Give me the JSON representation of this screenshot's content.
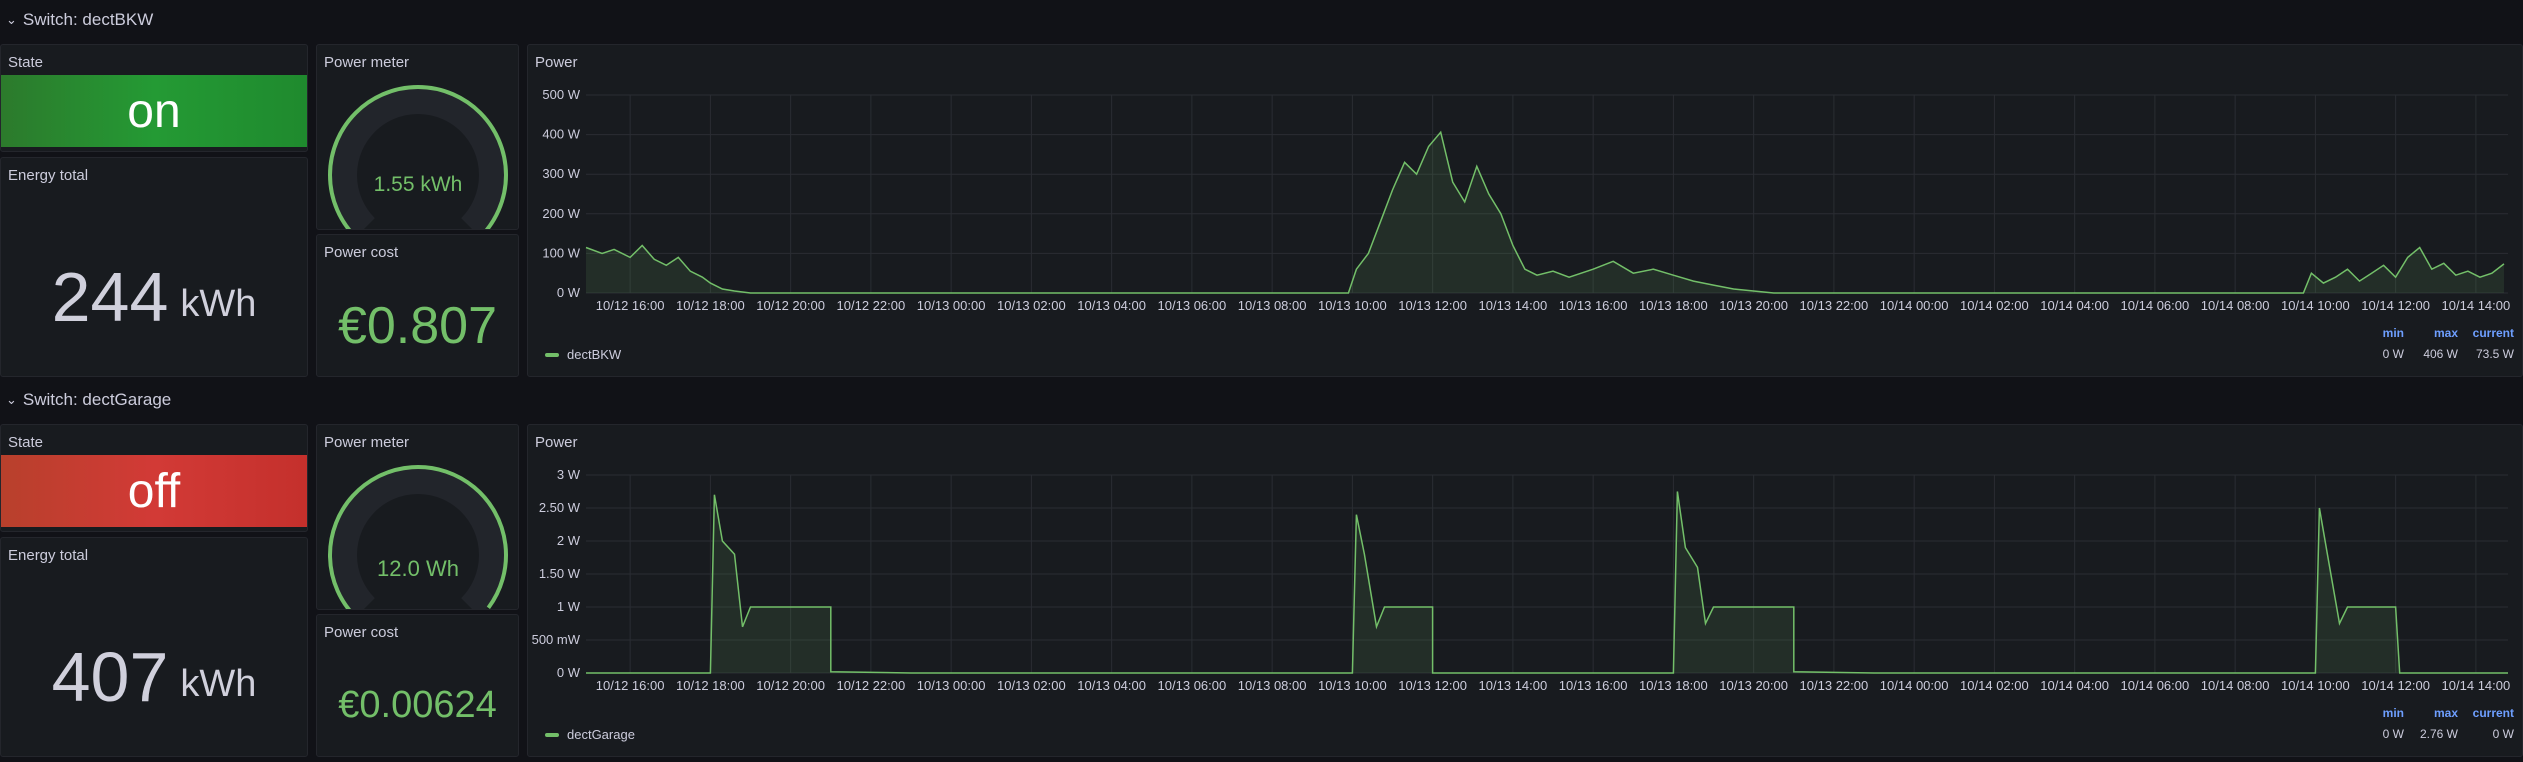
{
  "sections": [
    {
      "row_title": "Switch: dectBKW",
      "state": {
        "title": "State",
        "value": "on"
      },
      "energy": {
        "title": "Energy total",
        "value": "244",
        "unit": "kWh"
      },
      "meter": {
        "title": "Power meter",
        "value": "1.55 kWh",
        "gauge_fraction": 1.0
      },
      "cost": {
        "title": "Power cost",
        "value": "€0.807"
      },
      "chart_title": "Power",
      "legend": "dectBKW",
      "stats_headers": [
        "min",
        "max",
        "current"
      ],
      "stats_values": [
        "0 W",
        "406 W",
        "73.5 W"
      ]
    },
    {
      "row_title": "Switch: dectGarage",
      "state": {
        "title": "State",
        "value": "off"
      },
      "energy": {
        "title": "Energy total",
        "value": "407",
        "unit": "kWh"
      },
      "meter": {
        "title": "Power meter",
        "value": "12.0 Wh",
        "gauge_fraction": 0.97
      },
      "cost": {
        "title": "Power cost",
        "value": "€0.00624"
      },
      "chart_title": "Power",
      "legend": "dectGarage",
      "stats_headers": [
        "min",
        "max",
        "current"
      ],
      "stats_values": [
        "0 W",
        "2.76 W",
        "0 W"
      ]
    }
  ],
  "colors": {
    "accent": "#73bf69",
    "on": "#249a34",
    "off": "#d23a36",
    "stats_header": "#6e9fff"
  },
  "chart_data": [
    {
      "type": "area",
      "title": "Power",
      "series_name": "dectBKW",
      "x_start_hours": 0,
      "x_end_hours": 48,
      "y_ticks": [
        "0 W",
        "100 W",
        "200 W",
        "300 W",
        "400 W",
        "500 W"
      ],
      "y_tick_values": [
        0,
        100,
        200,
        300,
        400,
        500
      ],
      "ylim": [
        0,
        500
      ],
      "x_ticks": [
        "10/12 16:00",
        "10/12 18:00",
        "10/12 20:00",
        "10/12 22:00",
        "10/13 00:00",
        "10/13 02:00",
        "10/13 04:00",
        "10/13 06:00",
        "10/13 08:00",
        "10/13 10:00",
        "10/13 12:00",
        "10/13 14:00",
        "10/13 16:00",
        "10/13 18:00",
        "10/13 20:00",
        "10/13 22:00",
        "10/14 00:00",
        "10/14 02:00",
        "10/14 04:00",
        "10/14 06:00",
        "10/14 08:00",
        "10/14 10:00",
        "10/14 12:00",
        "10/14 14:00"
      ],
      "points": [
        [
          14.9,
          115
        ],
        [
          15.3,
          100
        ],
        [
          15.6,
          110
        ],
        [
          16.0,
          90
        ],
        [
          16.3,
          120
        ],
        [
          16.6,
          85
        ],
        [
          16.9,
          70
        ],
        [
          17.2,
          90
        ],
        [
          17.5,
          55
        ],
        [
          17.8,
          40
        ],
        [
          18.0,
          25
        ],
        [
          18.3,
          10
        ],
        [
          18.6,
          5
        ],
        [
          19,
          0
        ],
        [
          23.5,
          0
        ],
        [
          24,
          0
        ],
        [
          32,
          0
        ],
        [
          33.9,
          0
        ],
        [
          34.1,
          60
        ],
        [
          34.4,
          100
        ],
        [
          34.7,
          180
        ],
        [
          35.0,
          260
        ],
        [
          35.3,
          330
        ],
        [
          35.6,
          300
        ],
        [
          35.9,
          370
        ],
        [
          36.2,
          406
        ],
        [
          36.5,
          280
        ],
        [
          36.8,
          230
        ],
        [
          37.1,
          320
        ],
        [
          37.4,
          250
        ],
        [
          37.7,
          200
        ],
        [
          38.0,
          120
        ],
        [
          38.3,
          60
        ],
        [
          38.6,
          45
        ],
        [
          39.0,
          55
        ],
        [
          39.4,
          40
        ],
        [
          40.0,
          60
        ],
        [
          40.5,
          80
        ],
        [
          41.0,
          50
        ],
        [
          41.5,
          60
        ],
        [
          42.0,
          45
        ],
        [
          42.5,
          30
        ],
        [
          43.0,
          20
        ],
        [
          43.5,
          10
        ],
        [
          44.0,
          5
        ],
        [
          44.5,
          0
        ],
        [
          48.0,
          0
        ],
        [
          56.0,
          0
        ],
        [
          57.7,
          0
        ],
        [
          57.9,
          50
        ],
        [
          58.2,
          25
        ],
        [
          58.5,
          40
        ],
        [
          58.8,
          60
        ],
        [
          59.1,
          30
        ],
        [
          59.4,
          50
        ],
        [
          59.7,
          70
        ],
        [
          60.0,
          40
        ],
        [
          60.3,
          90
        ],
        [
          60.6,
          115
        ],
        [
          60.9,
          60
        ],
        [
          61.2,
          75
        ],
        [
          61.5,
          45
        ],
        [
          61.8,
          55
        ],
        [
          62.1,
          40
        ],
        [
          62.4,
          50
        ],
        [
          62.7,
          73.5
        ]
      ],
      "x_total_hours": 62.8
    },
    {
      "type": "area",
      "title": "Power",
      "series_name": "dectGarage",
      "y_ticks": [
        "0 W",
        "500 mW",
        "1 W",
        "1.50 W",
        "2 W",
        "2.50 W",
        "3 W"
      ],
      "y_tick_values": [
        0,
        0.5,
        1,
        1.5,
        2,
        2.5,
        3
      ],
      "ylim": [
        0,
        3
      ],
      "x_ticks": [
        "10/12 16:00",
        "10/12 18:00",
        "10/12 20:00",
        "10/12 22:00",
        "10/13 00:00",
        "10/13 02:00",
        "10/13 04:00",
        "10/13 06:00",
        "10/13 08:00",
        "10/13 10:00",
        "10/13 12:00",
        "10/13 14:00",
        "10/13 16:00",
        "10/13 18:00",
        "10/13 20:00",
        "10/13 22:00",
        "10/14 00:00",
        "10/14 02:00",
        "10/14 04:00",
        "10/14 06:00",
        "10/14 08:00",
        "10/14 10:00",
        "10/14 12:00",
        "10/14 14:00"
      ],
      "points": [
        [
          14.9,
          0
        ],
        [
          18.0,
          0
        ],
        [
          18.1,
          2.7
        ],
        [
          18.3,
          2.0
        ],
        [
          18.6,
          1.8
        ],
        [
          18.8,
          0.7
        ],
        [
          19.0,
          1.0
        ],
        [
          21.0,
          1.0
        ],
        [
          21.0,
          0.02
        ],
        [
          23.0,
          0
        ],
        [
          34.0,
          0
        ],
        [
          34.1,
          2.4
        ],
        [
          34.3,
          1.8
        ],
        [
          34.6,
          0.7
        ],
        [
          34.8,
          1.0
        ],
        [
          36.0,
          1.0
        ],
        [
          36.0,
          0
        ],
        [
          42.0,
          0
        ],
        [
          42.1,
          2.75
        ],
        [
          42.3,
          1.9
        ],
        [
          42.6,
          1.6
        ],
        [
          42.8,
          0.75
        ],
        [
          43.0,
          1.0
        ],
        [
          45.0,
          1.0
        ],
        [
          45.0,
          0.02
        ],
        [
          47.0,
          0
        ],
        [
          58.0,
          0
        ],
        [
          58.1,
          2.5
        ],
        [
          58.3,
          1.8
        ],
        [
          58.6,
          0.75
        ],
        [
          58.8,
          1.0
        ],
        [
          60.0,
          1.0
        ],
        [
          60.1,
          0
        ],
        [
          62.8,
          0
        ]
      ],
      "x_total_hours": 62.8
    }
  ]
}
